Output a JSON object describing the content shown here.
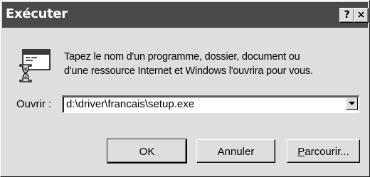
{
  "window": {
    "title": "Exécuter",
    "help_button": "?",
    "close_button": "×"
  },
  "dialog": {
    "icon": "run-program-icon",
    "description_line1": "Tapez le nom d'un programme, dossier, document ou",
    "description_line2": "d'une ressource Internet et Windows l'ouvrira pour vous.",
    "open_label": "Ouvrir :",
    "open_value": "d:\\driver\\francais\\setup.exe"
  },
  "buttons": {
    "ok": "OK",
    "cancel": "Annuler",
    "browse_first": "P",
    "browse_rest": "arcourir..."
  },
  "colors": {
    "titlebar": "#4a4a4a",
    "face": "#dedede"
  }
}
